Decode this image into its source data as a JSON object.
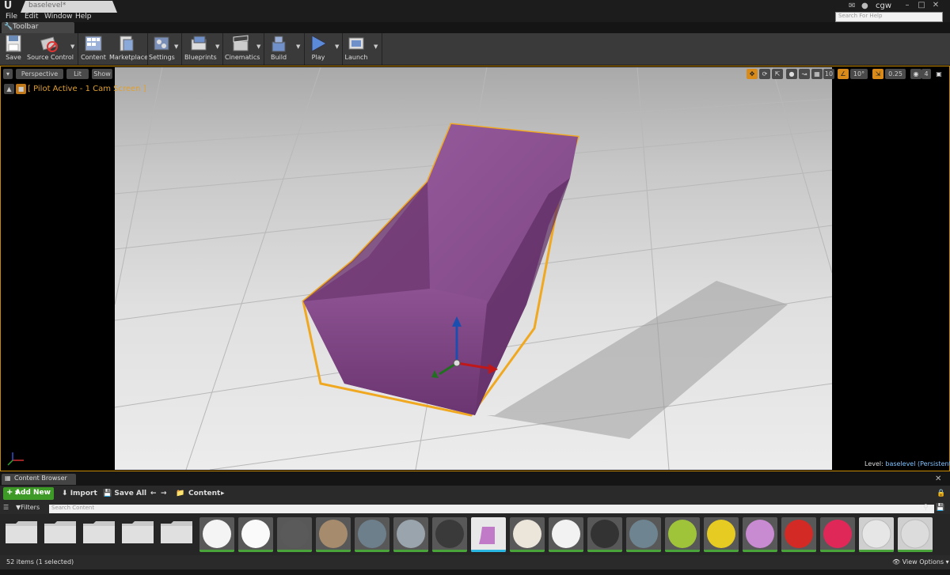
{
  "window": {
    "tab_title": "baselevel*",
    "user": "cgw",
    "search_help_placeholder": "Search For Help"
  },
  "menu": [
    "File",
    "Edit",
    "Window",
    "Help"
  ],
  "toolbar_panel": {
    "tab_label": "Toolbar"
  },
  "toolbar": {
    "save": "Save",
    "source_control": "Source Control",
    "content": "Content",
    "marketplace": "Marketplace",
    "settings": "Settings",
    "blueprints": "Blueprints",
    "cinematics": "Cinematics",
    "build": "Build",
    "play": "Play",
    "launch": "Launch"
  },
  "viewport": {
    "view_mode": "Perspective",
    "lighting": "Lit",
    "show": "Show",
    "pilot_text": "[ Pilot Active - 1 Cam Screen ]",
    "grid_snap": "10",
    "rotation_snap": "10°",
    "scale_snap": "0.25",
    "camera_speed": "4",
    "level_prefix": "Level:",
    "level_name": "baselevel (Persistent)"
  },
  "content_browser": {
    "tab_label": "Content Browser",
    "add_new": "Add New",
    "import": "Import",
    "save_all": "Save All",
    "path": "Content",
    "filters": "Filters",
    "search_placeholder": "Search Content",
    "status": "52 items (1 selected)",
    "view_options": "View Options"
  },
  "colors": {
    "accent_orange": "#d98b1a",
    "add_new_green": "#3e9a27",
    "chair_purple": "#8a4f8d",
    "level_blue": "#7fc3ff"
  }
}
